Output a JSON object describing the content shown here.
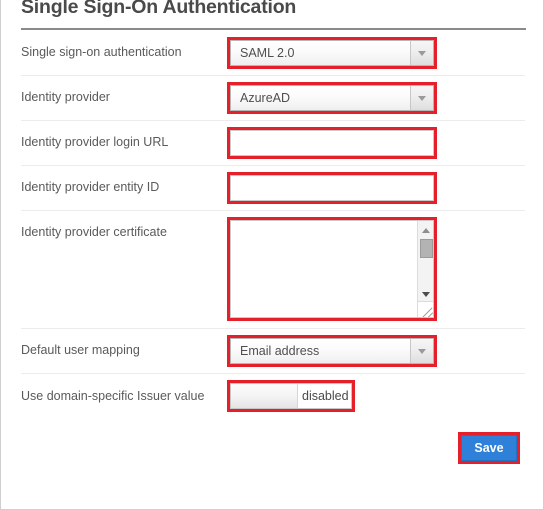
{
  "panel": {
    "title": "Single Sign-On Authentication"
  },
  "rows": [
    {
      "label": "Single sign-on authentication",
      "type": "select",
      "value": "SAML 2.0",
      "highlighted": true
    },
    {
      "label": "Identity provider",
      "type": "select",
      "value": "AzureAD",
      "highlighted": true
    },
    {
      "label": "Identity provider login URL",
      "type": "text",
      "value": "",
      "placeholder": "",
      "highlighted": true
    },
    {
      "label": "Identity provider entity ID",
      "type": "text",
      "value": "",
      "placeholder": "",
      "highlighted": true
    },
    {
      "label": "Identity provider certificate",
      "type": "textarea",
      "value": "",
      "placeholder": "",
      "highlighted": true
    },
    {
      "label": "Default user mapping",
      "type": "select",
      "value": "Email address",
      "highlighted": true
    },
    {
      "label": "Use domain-specific Issuer value",
      "type": "toggle",
      "value": "disabled",
      "highlighted": true
    }
  ],
  "actions": {
    "save_label": "Save"
  },
  "colors": {
    "highlight": "#e5202a",
    "save_button": "#2f80d8",
    "label_text": "#5a5a5a",
    "title_text": "#4a4a4a",
    "rule": "#8a8a8a",
    "row_divider": "#ececec"
  }
}
